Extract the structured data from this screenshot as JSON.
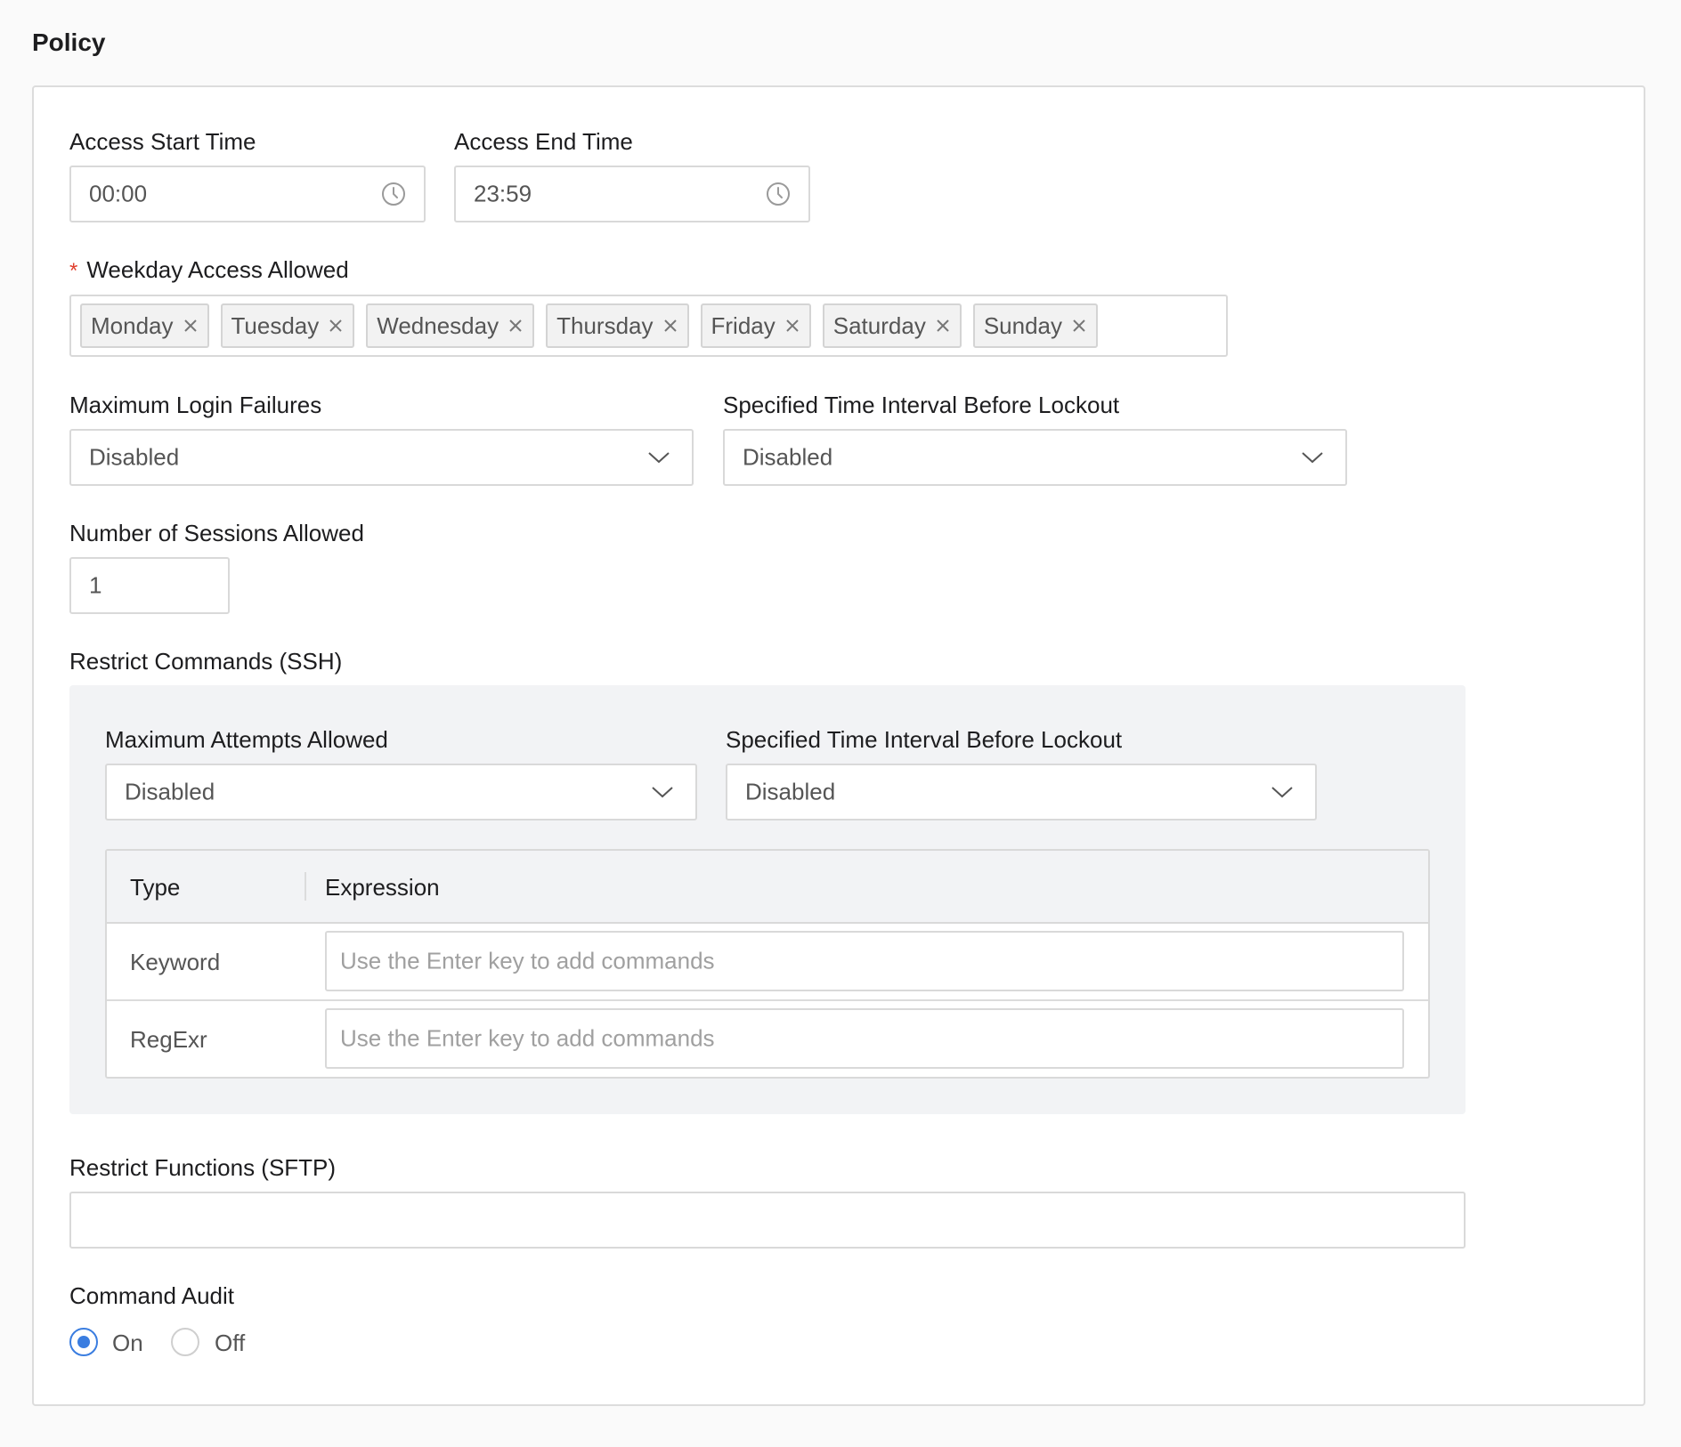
{
  "section": {
    "title": "Policy"
  },
  "access_start": {
    "label": "Access Start Time",
    "value": "00:00",
    "icon": "clock-icon"
  },
  "access_end": {
    "label": "Access End Time",
    "value": "23:59",
    "icon": "clock-icon"
  },
  "weekday": {
    "required_marker": "*",
    "label": "Weekday Access Allowed",
    "tags": [
      "Monday",
      "Tuesday",
      "Wednesday",
      "Thursday",
      "Friday",
      "Saturday",
      "Sunday"
    ]
  },
  "max_login_failures": {
    "label": "Maximum Login Failures",
    "value": "Disabled"
  },
  "lockout_interval": {
    "label": "Specified Time Interval Before Lockout",
    "value": "Disabled"
  },
  "sessions": {
    "label": "Number of Sessions Allowed",
    "value": "1"
  },
  "restrict_commands": {
    "label": "Restrict Commands (SSH)",
    "max_attempts": {
      "label": "Maximum Attempts Allowed",
      "value": "Disabled"
    },
    "lockout_interval": {
      "label": "Specified Time Interval Before Lockout",
      "value": "Disabled"
    },
    "table": {
      "headers": [
        "Type",
        "Expression"
      ],
      "rows": [
        {
          "type": "Keyword",
          "placeholder": "Use the Enter key to add commands"
        },
        {
          "type": "RegExr",
          "placeholder": "Use the Enter key to add commands"
        }
      ]
    }
  },
  "restrict_functions": {
    "label": "Restrict Functions (SFTP)",
    "value": ""
  },
  "command_audit": {
    "label": "Command Audit",
    "options": [
      {
        "label": "On",
        "selected": true
      },
      {
        "label": "Off",
        "selected": false
      }
    ]
  },
  "colors": {
    "accent": "#3a7de0",
    "required": "#e03e2d",
    "panel_bg": "#f2f3f5"
  }
}
